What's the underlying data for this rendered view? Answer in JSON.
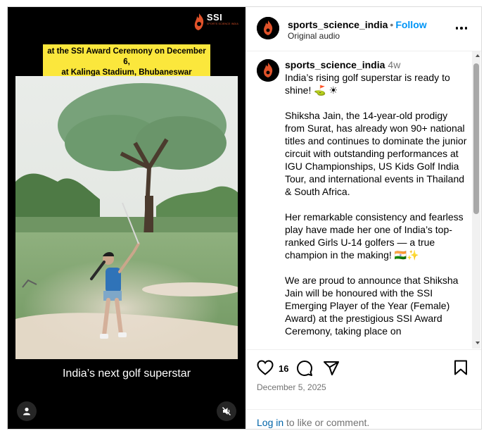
{
  "media": {
    "brand_text": "SSI",
    "brand_tagline": "SPORTS SCIENCE INDIA",
    "banner_line1": "at the SSI Award Ceremony on December 6,",
    "banner_line2": "at Kalinga Stadium, Bhubaneswar",
    "caption": "India’s next golf superstar"
  },
  "header": {
    "username": "sports_science_india",
    "separator": "•",
    "follow_label": "Follow",
    "audio_label": "Original audio"
  },
  "post": {
    "username": "sports_science_india",
    "age": "4w",
    "body": "India’s rising golf superstar is ready to shine! ⛳ ☀\n\nShiksha Jain, the 14-year-old prodigy from Surat, has already won 90+ national titles and continues to dominate the junior circuit with outstanding performances at IGU Championships, US Kids Golf India Tour, and international events in Thailand & South Africa.\n\nHer remarkable consistency and fearless play have made her one of India’s top-ranked Girls U-14 golfers — a true champion in the making! 🇮🇳✨\n\nWe are proud to announce that Shiksha Jain will be honoured with the SSI Emerging Player of the Year (Female) Award) at the prestigious SSI Award Ceremony, taking place on"
  },
  "actions": {
    "like_count": "16",
    "date": "December 5, 2025",
    "login_link": "Log in",
    "login_rest": " to like or comment."
  },
  "colors": {
    "accent": "#0095f6",
    "banner": "#fbe73c",
    "brand": "#e0522a"
  }
}
